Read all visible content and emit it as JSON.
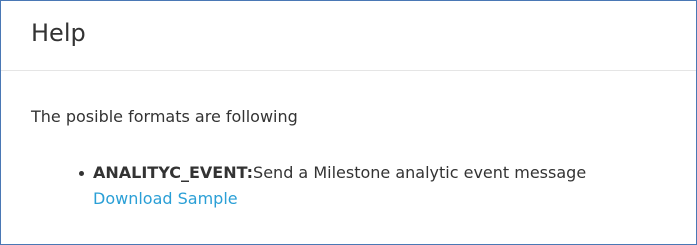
{
  "panel": {
    "title": "Help"
  },
  "body": {
    "intro": "The posible formats are following",
    "formats": [
      {
        "name": "ANALITYC_EVENT:",
        "description": "Send a Milestone analytic event message",
        "link_label": "Download Sample"
      }
    ]
  },
  "colors": {
    "border": "#4a78b5",
    "link": "#2a9fd6",
    "text": "#333333"
  }
}
